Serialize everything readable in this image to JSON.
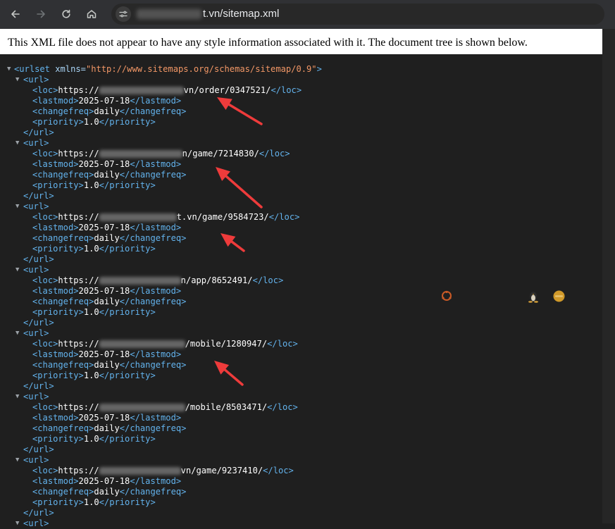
{
  "browser": {
    "url_suffix": "t.vn/sitemap.xml"
  },
  "info_message": "This XML file does not appear to have any style information associated with it. The document tree is shown below.",
  "xml": {
    "root_open_tag": "<urlset",
    "root_attr_name": " xmlns=",
    "root_attr_value": "\"http://www.sitemaps.org/schemas/sitemap/0.9\"",
    "root_open_end": ">",
    "url_open": "<url>",
    "url_close": "</url>",
    "loc_open": "<loc>",
    "loc_close": "</loc>",
    "lastmod_open": "<lastmod>",
    "lastmod_close": "</lastmod>",
    "changefreq_open": "<changefreq>",
    "changefreq_close": "</changefreq>",
    "priority_open": "<priority>",
    "priority_close": "</priority>",
    "loc_prefix": "https://",
    "entries": [
      {
        "loc_suffix": "vn/order/0347521/",
        "lastmod": "2025-07-18",
        "changefreq": "daily",
        "priority": "1.0"
      },
      {
        "loc_suffix": "n/game/7214830/",
        "lastmod": "2025-07-18",
        "changefreq": "daily",
        "priority": "1.0"
      },
      {
        "loc_suffix": "t.vn/game/9584723/",
        "lastmod": "2025-07-18",
        "changefreq": "daily",
        "priority": "1.0"
      },
      {
        "loc_suffix": "n/app/8652491/",
        "lastmod": "2025-07-18",
        "changefreq": "daily",
        "priority": "1.0"
      },
      {
        "loc_suffix": "/mobile/1280947/",
        "lastmod": "2025-07-18",
        "changefreq": "daily",
        "priority": "1.0"
      },
      {
        "loc_suffix": "/mobile/8503471/",
        "lastmod": "2025-07-18",
        "changefreq": "daily",
        "priority": "1.0"
      },
      {
        "loc_suffix": "vn/game/9237410/",
        "lastmod": "2025-07-18",
        "changefreq": "daily",
        "priority": "1.0"
      }
    ]
  },
  "annotation": {
    "arrow_color": "#ee3b3b"
  }
}
